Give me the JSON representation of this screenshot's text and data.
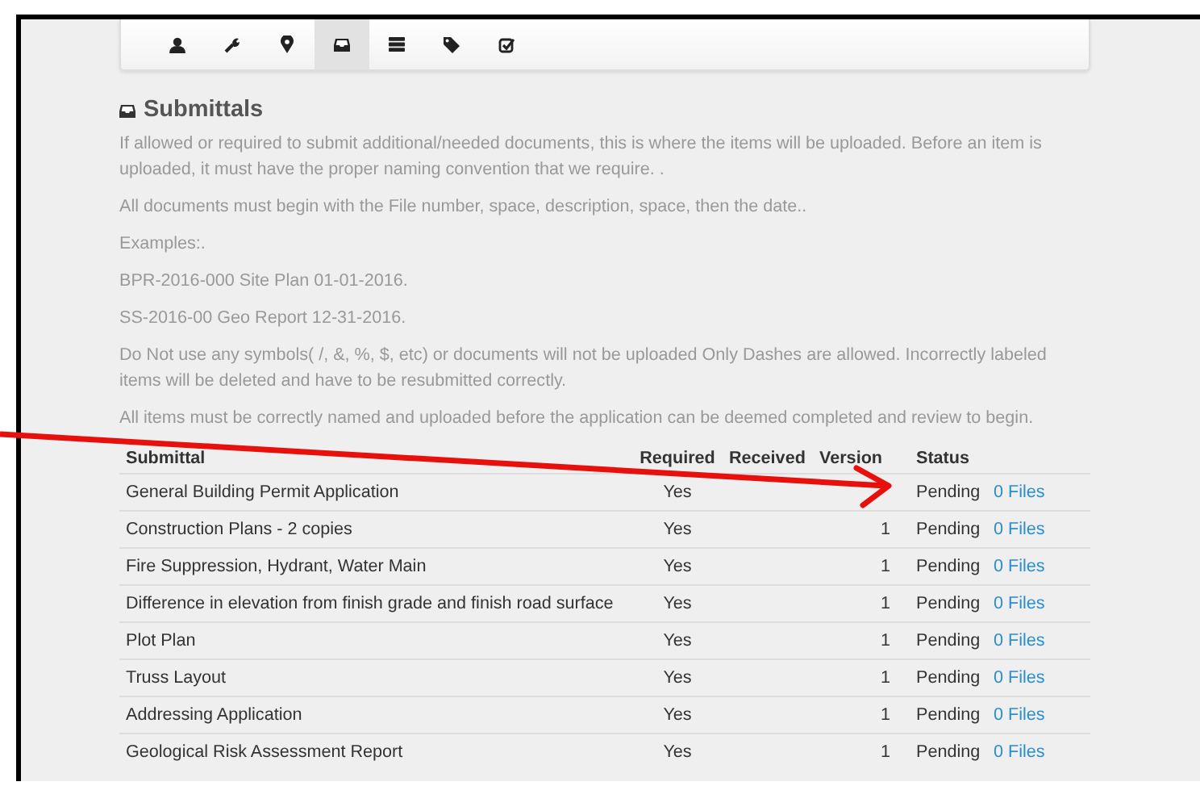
{
  "toolbar": {
    "tabs": [
      {
        "selected": false
      },
      {
        "selected": false
      },
      {
        "selected": false
      },
      {
        "selected": true
      },
      {
        "selected": false
      },
      {
        "selected": false
      },
      {
        "selected": false
      }
    ]
  },
  "section": {
    "title": "Submittals",
    "paragraphs": [
      "If allowed or required to submit additional/needed documents, this is where the items will be uploaded. Before an item is uploaded, it must have the proper naming convention that we require. .",
      "All documents must begin with the File number, space, description, space, then the date..",
      "Examples:.",
      "BPR-2016-000 Site Plan 01-01-2016.",
      "SS-2016-00 Geo Report 12-31-2016.",
      "Do Not use any symbols( /, &, %, $, etc) or documents will not be uploaded Only Dashes are allowed. Incorrectly labeled items will be deleted and have to be resubmitted correctly.",
      "All items must be correctly named and uploaded before the application can be deemed completed and review to begin."
    ]
  },
  "table": {
    "columns": [
      "Submittal",
      "Required",
      "Received",
      "Version",
      "Status"
    ],
    "rows": [
      {
        "submittal": "General Building Permit Application",
        "required": "Yes",
        "status": "Pending",
        "files": "0 Files"
      },
      {
        "submittal": "Construction Plans - 2 copies",
        "required": "Yes",
        "version": "1",
        "status": "Pending",
        "files": "0 Files"
      },
      {
        "submittal": "Fire Suppression, Hydrant, Water Main",
        "required": "Yes",
        "version": "1",
        "status": "Pending",
        "files": "0 Files"
      },
      {
        "submittal": "Difference in elevation from finish grade and finish road surface",
        "required": "Yes",
        "version": "1",
        "status": "Pending",
        "files": "0 Files"
      },
      {
        "submittal": "Plot Plan",
        "required": "Yes",
        "version": "1",
        "status": "Pending",
        "files": "0 Files"
      },
      {
        "submittal": "Truss Layout",
        "required": "Yes",
        "version": "1",
        "status": "Pending",
        "files": "0 Files"
      },
      {
        "submittal": "Addressing Application",
        "required": "Yes",
        "version": "1",
        "status": "Pending",
        "files": "0 Files"
      },
      {
        "submittal": "Geological Risk Assessment Report",
        "required": "Yes",
        "version": "1",
        "status": "Pending",
        "files": "0 Files"
      }
    ]
  }
}
